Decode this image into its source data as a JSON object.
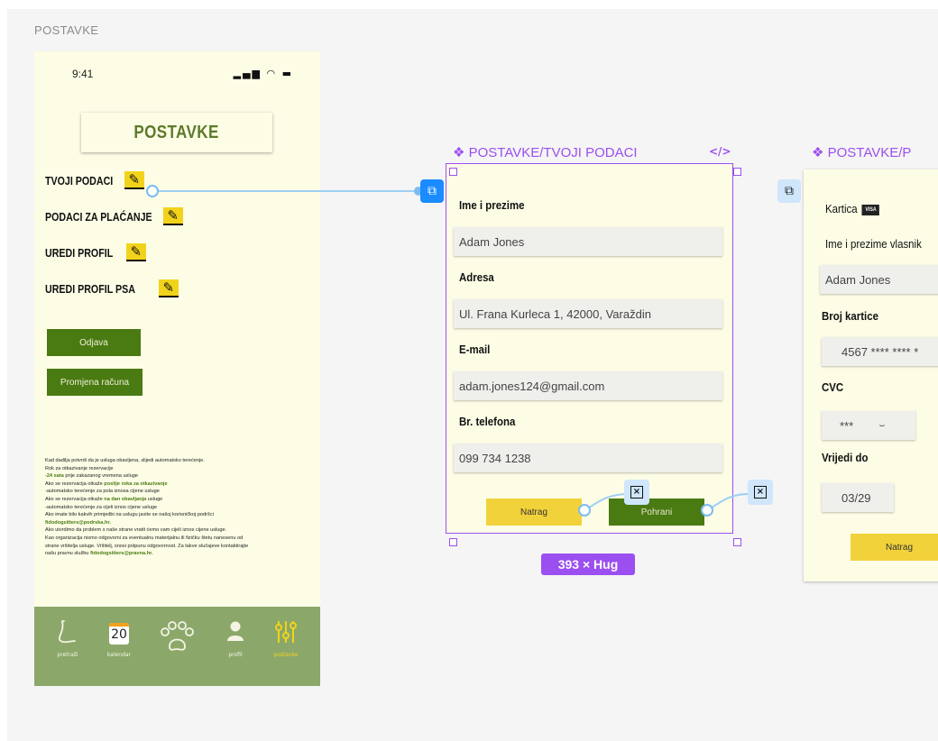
{
  "canvas": {
    "frame_label": "POSTAVKE"
  },
  "phone": {
    "status_time": "9:41",
    "status_icons": "▂▄▆ ◠ ▬",
    "title": "POSTAVKE",
    "menu": [
      {
        "label": "TVOJI PODACI",
        "icon": "pencil-icon"
      },
      {
        "label": "PODACI ZA PLAĆANJE",
        "icon": "pencil-icon"
      },
      {
        "label": "UREDI PROFIL",
        "icon": "pencil-icon"
      },
      {
        "label": "UREDI PROFIL PSA",
        "icon": "pencil-icon"
      }
    ],
    "logout_label": "Odjava",
    "change_account_label": "Promjena računa",
    "info": {
      "l1": "Kad dadilja potvrdi da je usluga obavljena, slijedi automatsko terećenje.",
      "l2": "Rok za otkazivanje rezervacije",
      "l3a": "-24 sata",
      "l3b": " prije zakazanog vremena usluge",
      "l4a": "Ako se rezervacija otkaže ",
      "l4b": "poslije roka za otkazivanje",
      "l5": "-automatsko terećenje za pola iznosa cijene usluge",
      "l6a": "Ako se rezervacija otkaže ",
      "l6b": "na dan obavljanja",
      "l6c": " usluge",
      "l7": "-automatsko terećenje za cijeli iznos cijene usluge",
      "l8": "Ako imate bilo kakvih primjedbi na uslugu javite se našoj korisničkoj podršci",
      "l9": "fidodogsitters@podrska.hr.",
      "l10": "Ako utvrdimo da problem s naše strane vratit ćemo vam cijeli iznos cijene usluge.",
      "l11": "Kao organizacija nismo odgovorni za eventualnu materijalnu ili fizičku štetu nanesenu od",
      "l12": "strane vršitelja usluge. Vršitelj, snosi potpunu odgovornost. Za takve slučajeve kontaktirajte",
      "l13a": "našu pravnu službu ",
      "l13b": "fidodogsitters@pravna.hr."
    },
    "nav": [
      {
        "label": "pretraži",
        "icon": "search-icon"
      },
      {
        "label": "kalendar",
        "icon": "calendar-icon",
        "day": "20"
      },
      {
        "label": "",
        "icon": "paw-icon"
      },
      {
        "label": "profil",
        "icon": "profile-icon"
      },
      {
        "label": "postavke",
        "icon": "settings-sliders-icon"
      }
    ]
  },
  "component_tvoji": {
    "label": "❖ POSTAVKE/TVOJI PODACI",
    "code_icon": "</>",
    "fields": [
      {
        "label": "Ime i prezime",
        "value": "Adam Jones"
      },
      {
        "label": "Adresa",
        "value": "Ul. Frana Kurleca 1, 42000, Varaždin"
      },
      {
        "label": "E-mail",
        "value": "adam.jones124@gmail.com"
      },
      {
        "label": "Br. telefona",
        "value": "099 734 1238"
      }
    ],
    "back_label": "Natrag",
    "save_label": "Pohrani",
    "size_badge": "393 × Hug"
  },
  "component_placanje": {
    "label": "❖ POSTAVKE/P",
    "card_label": "Kartica",
    "visa": "VISA",
    "owner_label": "Ime i prezime vlasnik",
    "owner_value": "Adam Jones",
    "number_label": "Broj kartice",
    "number_value": "4567 **** **** *",
    "cvc_label": "CVC",
    "cvc_value": "***",
    "expiry_label": "Vrijedi do",
    "expiry_value": "03/29",
    "back_label": "Natrag"
  },
  "colors": {
    "accent_purple": "#9b4ff0",
    "olive_green": "#4a7a12",
    "yellow": "#f2d23a",
    "cream": "#fdfde6",
    "blue": "#1a8cff"
  }
}
